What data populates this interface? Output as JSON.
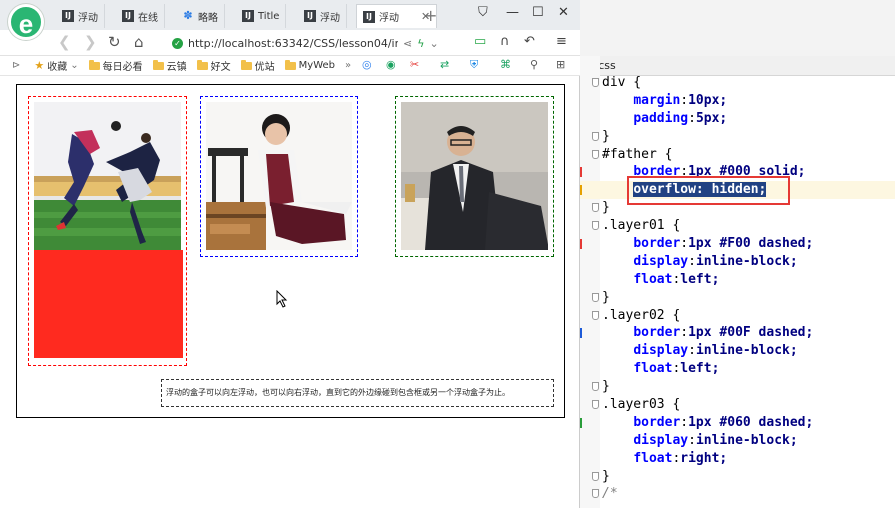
{
  "tabs": [
    {
      "label": "浮动",
      "icon": "IJ"
    },
    {
      "label": "在线",
      "icon": "IJ"
    },
    {
      "label": "略略",
      "icon": "paw"
    },
    {
      "label": "Title",
      "icon": "IJ"
    },
    {
      "label": "浮动",
      "icon": "IJ"
    },
    {
      "label": "浮动",
      "icon": "IJ",
      "active": true
    }
  ],
  "address": {
    "url": "http://localhost:63342/CSS/lesson04/inde"
  },
  "bookmarks": [
    {
      "label": "收藏",
      "type": "star"
    },
    {
      "label": "每日必看",
      "type": "folder"
    },
    {
      "label": "云镇",
      "type": "folder"
    },
    {
      "label": "好文",
      "type": "folder"
    },
    {
      "label": "优站",
      "type": "folder"
    },
    {
      "label": "MyWeb",
      "type": "folder"
    }
  ],
  "page": {
    "float_text": "浮动的盒子可以向左浮动，也可以向右浮动，直到它的外边缘碰到包含框或另一个浮动盒子为止。"
  },
  "editor": {
    "file_tab": "e.css",
    "colors": {
      "highlight_box": "#e53935",
      "selection": "#214283"
    },
    "lines": [
      {
        "selector": "div {"
      },
      {
        "prop": "margin",
        "value": "10px;"
      },
      {
        "prop": "padding",
        "value": "5px;"
      },
      {
        "brace": "}"
      },
      {
        "selector": "#father {"
      },
      {
        "prop": "border",
        "value": "1px #000 solid;"
      },
      {
        "selected": "overflow: hidden;",
        "highlighted": true
      },
      {
        "brace": "}"
      },
      {
        "selector": ".layer01 {"
      },
      {
        "prop": "border",
        "value": "1px #F00 dashed;"
      },
      {
        "prop": "display",
        "value": "inline-block;"
      },
      {
        "prop": "float",
        "value": "left;"
      },
      {
        "brace": "}"
      },
      {
        "selector": ".layer02 {"
      },
      {
        "prop": "border",
        "value": "1px #00F dashed;"
      },
      {
        "prop": "display",
        "value": "inline-block;"
      },
      {
        "prop": "float",
        "value": "left;"
      },
      {
        "brace": "}"
      },
      {
        "selector": ".layer03 {"
      },
      {
        "prop": "border",
        "value": "1px #060 dashed;"
      },
      {
        "prop": "display",
        "value": "inline-block;"
      },
      {
        "prop": "float",
        "value": "right;"
      },
      {
        "brace": "}"
      },
      {
        "comment": "/*"
      }
    ]
  }
}
